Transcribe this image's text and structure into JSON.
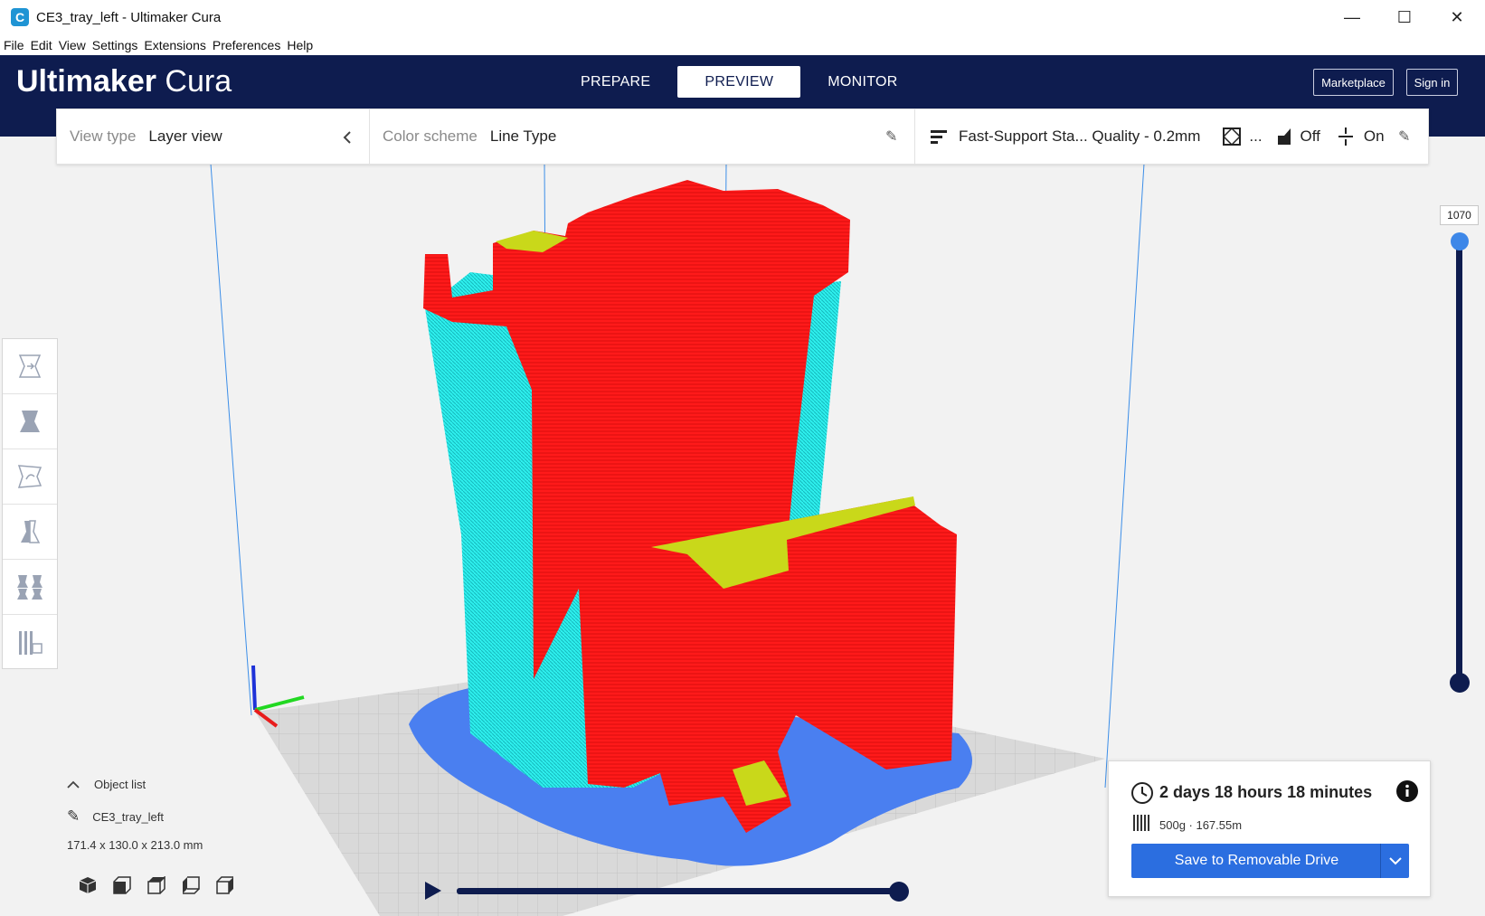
{
  "window": {
    "title": "CE3_tray_left - Ultimaker Cura",
    "minimize_glyph": "—",
    "maximize_glyph": "☐",
    "close_glyph": "✕"
  },
  "menu": [
    "File",
    "Edit",
    "View",
    "Settings",
    "Extensions",
    "Preferences",
    "Help"
  ],
  "header": {
    "brand_strong": "Ultimaker",
    "brand_light": "Cura",
    "tabs": [
      {
        "label": "PREPARE",
        "active": false
      },
      {
        "label": "PREVIEW",
        "active": true
      },
      {
        "label": "MONITOR",
        "active": false
      }
    ],
    "marketplace_label": "Marketplace",
    "signin_label": "Sign in"
  },
  "settings_bar": {
    "view_type_label": "View type",
    "view_type_value": "Layer view",
    "color_scheme_label": "Color scheme",
    "color_scheme_value": "Line Type",
    "profile_value": "Fast-Support Sta... Quality - 0.2mm",
    "infill_value": "...",
    "support_value": "Off",
    "adhesion_value": "On"
  },
  "layer_slider": {
    "current_layer": "1070"
  },
  "object_list": {
    "label": "Object list",
    "object_name": "CE3_tray_left",
    "dimensions": "171.4 x 130.0 x 213.0 mm"
  },
  "print_info": {
    "time": "2 days 18 hours 18 minutes",
    "material": "500g · 167.55m",
    "save_label": "Save to Removable Drive"
  },
  "colors": {
    "header_bg": "#0e1c4f",
    "accent_blue": "#2b6ee0",
    "wall_red": "#ff1a1a",
    "support_cyan": "#2ef0ee",
    "skirt_blue": "#4a7ff0",
    "top_skin_yellow": "#c9d81a"
  }
}
